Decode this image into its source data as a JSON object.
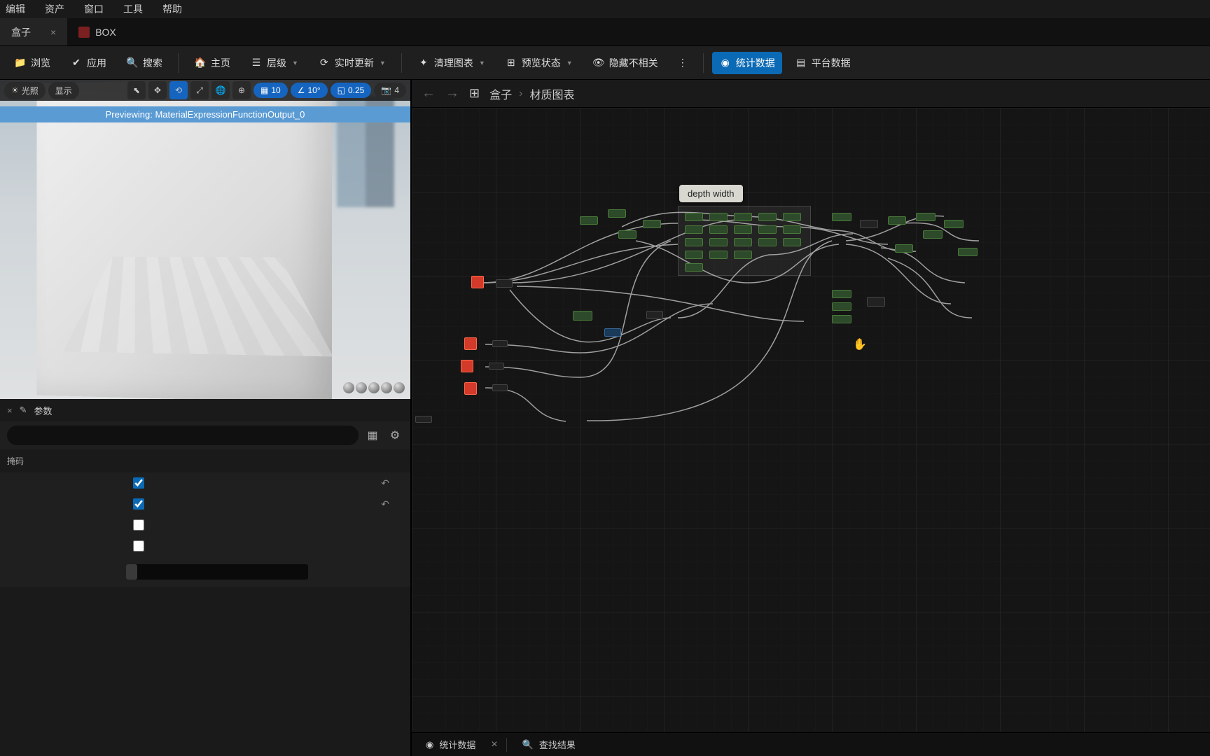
{
  "menu": {
    "edit": "编辑",
    "asset": "资产",
    "window": "窗口",
    "tools": "工具",
    "help": "帮助"
  },
  "tabs": {
    "active": "盒子",
    "second": "BOX"
  },
  "toolbar": {
    "browse": "浏览",
    "apply": "应用",
    "search": "搜索",
    "home": "主页",
    "hierarchy": "层级",
    "live_update": "实时更新",
    "clean_graph": "清理图表",
    "preview_state": "预览状态",
    "hide_unrelated": "隐藏不相关",
    "stats": "统计数据",
    "platform_data": "平台数据"
  },
  "viewport": {
    "lighting": "光照",
    "display": "显示",
    "grid_snap": "10",
    "angle_snap": "10°",
    "scale_snap": "0.25",
    "camera_speed": "4",
    "preview_label": "Previewing: MaterialExpressionFunctionOutput_0"
  },
  "panel": {
    "params_label": "参数",
    "section": "掩码",
    "row1_checked": true,
    "row2_checked": true,
    "row3_checked": false,
    "row4_checked": false
  },
  "graph": {
    "bc_root": "盒子",
    "bc_current": "材质图表",
    "tooltip": "depth width"
  },
  "bottom": {
    "stats": "统计数据",
    "search_results": "查找结果"
  }
}
